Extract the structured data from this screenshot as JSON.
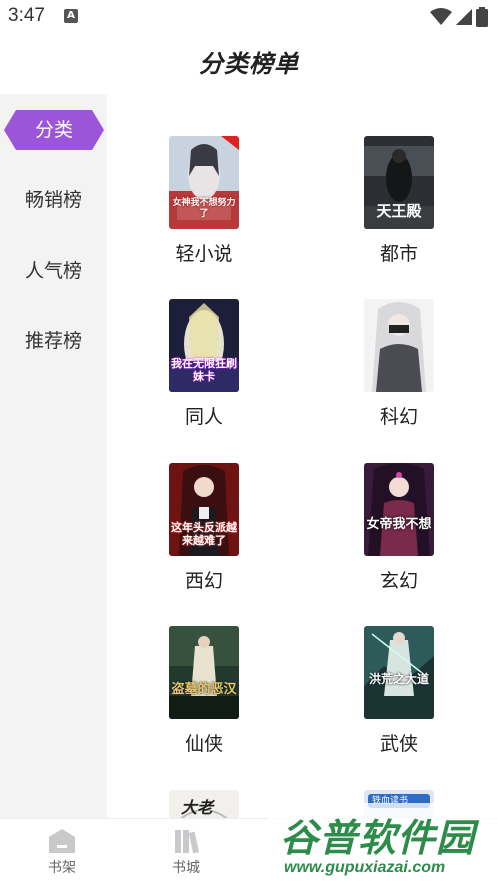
{
  "status_bar": {
    "time": "3:47",
    "notif_letter": "A"
  },
  "header": {
    "title": "分类榜单"
  },
  "sidebar": {
    "items": [
      {
        "label": "分类",
        "active": true
      },
      {
        "label": "畅销榜",
        "active": false
      },
      {
        "label": "人气榜",
        "active": false
      },
      {
        "label": "推荐榜",
        "active": false
      }
    ]
  },
  "categories": [
    {
      "label": "轻小说",
      "cover_text": "女神我不想努力了"
    },
    {
      "label": "都市",
      "cover_text": "天王殿"
    },
    {
      "label": "同人",
      "cover_text": "我在无限狂刷妹卡"
    },
    {
      "label": "科幻",
      "cover_text": ""
    },
    {
      "label": "西幻",
      "cover_text": "这年头反派越来越难了"
    },
    {
      "label": "玄幻",
      "cover_text": "女帝我不想"
    },
    {
      "label": "仙侠",
      "cover_text": "盗墓的恶汉"
    },
    {
      "label": "武侠",
      "cover_text": "洪荒之大道"
    }
  ],
  "partial_row": [
    {
      "cover_text": "大老"
    },
    {
      "cover_text": "铁血读书"
    }
  ],
  "bottom_nav": {
    "items": [
      {
        "label": "书架"
      },
      {
        "label": "书城"
      }
    ]
  },
  "watermark": {
    "title": "谷普软件园",
    "url": "www.gupuxiazai.com"
  },
  "colors": {
    "accent": "#9b55d8",
    "watermark": "#2e8c4b",
    "sidebar_bg": "#f3f3f3"
  }
}
